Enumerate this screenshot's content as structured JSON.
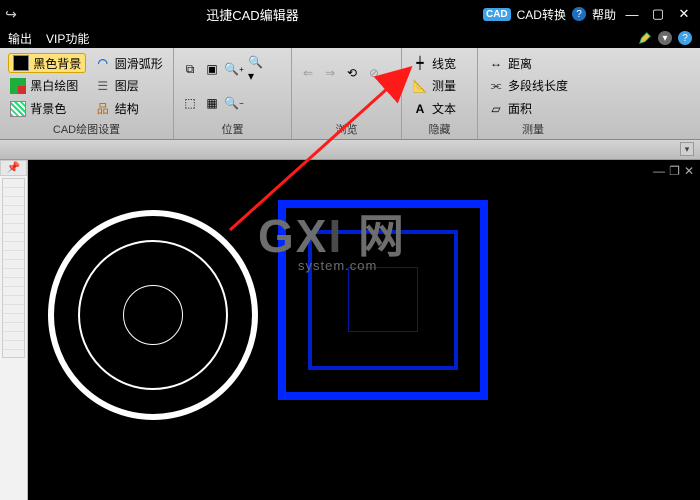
{
  "title": "迅捷CAD编辑器",
  "titlebar": {
    "cad_badge": "CAD",
    "convert": "CAD转换",
    "help": "帮助"
  },
  "menubar": {
    "items": [
      "输出",
      "VIP功能"
    ]
  },
  "ribbon": {
    "groups": [
      {
        "label": "CAD绘图设置",
        "items": [
          {
            "id": "black-bg",
            "text": "黑色背景",
            "active": true
          },
          {
            "id": "bw-draw",
            "text": "黑白绘图"
          },
          {
            "id": "bg-color",
            "text": "背景色"
          },
          {
            "id": "smooth-arc",
            "text": "圆滑弧形"
          },
          {
            "id": "layer",
            "text": "图层"
          },
          {
            "id": "structure",
            "text": "结构"
          }
        ]
      },
      {
        "label": "位置"
      },
      {
        "label": "浏览"
      },
      {
        "label": "隐藏",
        "items": [
          {
            "id": "lineweight",
            "text": "线宽"
          },
          {
            "id": "measure",
            "text": "测量"
          },
          {
            "id": "text",
            "text": "文本"
          }
        ]
      },
      {
        "label": "测量",
        "items": [
          {
            "id": "distance",
            "text": "距离"
          },
          {
            "id": "polyline-length",
            "text": "多段线长度"
          },
          {
            "id": "area",
            "text": "面积"
          }
        ]
      }
    ]
  },
  "watermark": {
    "line1_a": "GX",
    "line1_b": "I",
    "line1_c": " 网",
    "line2": "system.com"
  }
}
